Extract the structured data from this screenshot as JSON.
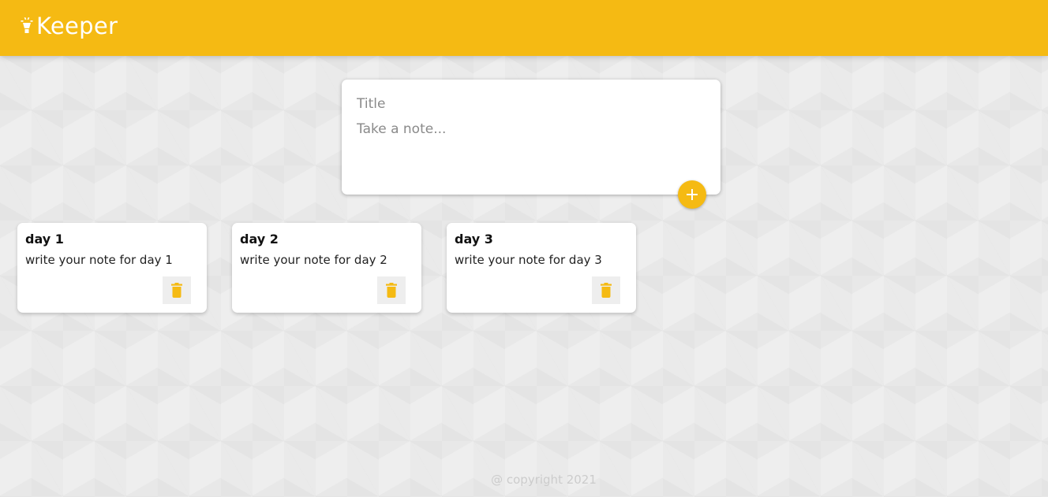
{
  "header": {
    "title": "Keeper",
    "icon": "lightbulb-icon"
  },
  "create_note": {
    "title_placeholder": "Title",
    "title_value": "",
    "content_placeholder": "Take a note...",
    "content_value": "",
    "add_icon": "plus-icon"
  },
  "notes": [
    {
      "title": "day 1",
      "content": "write your note for day 1",
      "delete_icon": "trash-icon"
    },
    {
      "title": "day 2",
      "content": "write your note for day 2",
      "delete_icon": "trash-icon"
    },
    {
      "title": "day 3",
      "content": "write your note for day 3",
      "delete_icon": "trash-icon"
    }
  ],
  "footer": {
    "copyright": "@ copyright 2021"
  },
  "colors": {
    "accent": "#f5ba13",
    "background": "#eeeeee",
    "card": "#ffffff",
    "footer_text": "#cccccc"
  }
}
